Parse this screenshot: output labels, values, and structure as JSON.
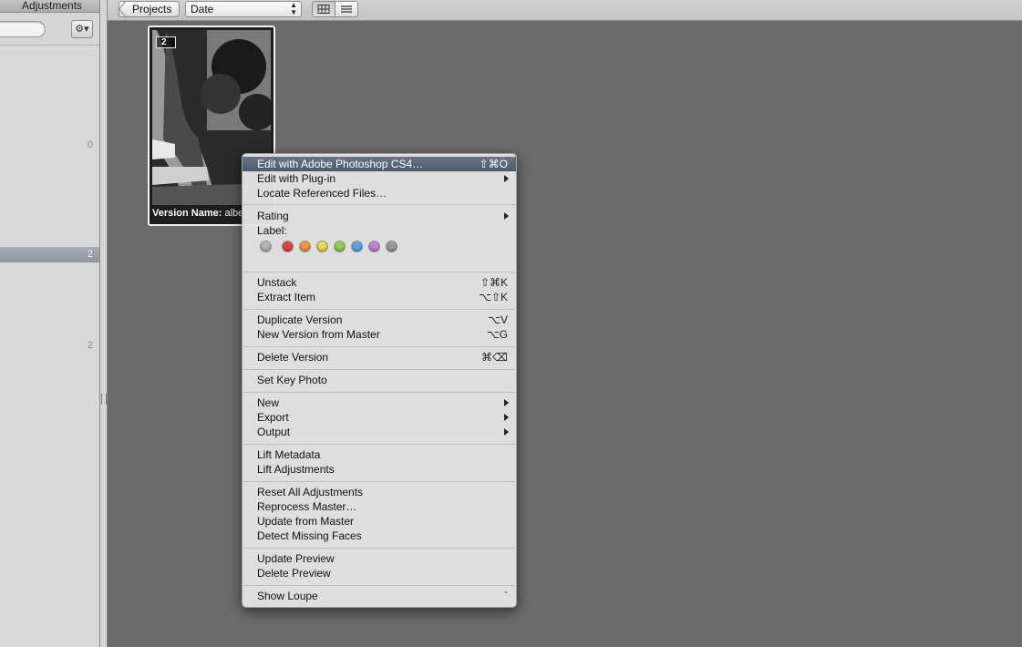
{
  "sidebar": {
    "tab_label": "Adjustments",
    "counts": [
      "0",
      "2",
      "2"
    ]
  },
  "toolbar": {
    "projects_label": "Projects",
    "sort_value": "Date"
  },
  "thumbnail": {
    "stack_count": "2",
    "caption_label": "Version Name:",
    "caption_value": "albe"
  },
  "menu": {
    "items": [
      {
        "label": "Edit with Adobe Photoshop CS4…",
        "shortcut": "⇧⌘O"
      },
      {
        "label": "Edit with Plug-in",
        "submenu": true
      },
      {
        "label": "Locate Referenced Files…"
      },
      {
        "label": "Rating",
        "submenu": true
      },
      {
        "label": "Label:"
      },
      {
        "label": "Unstack",
        "shortcut": "⇧⌘K"
      },
      {
        "label": "Extract Item",
        "shortcut": "⌥⇧K"
      },
      {
        "label": "Duplicate Version",
        "shortcut": "⌥V"
      },
      {
        "label": "New Version from Master",
        "shortcut": "⌥G"
      },
      {
        "label": "Delete Version",
        "shortcut": "⌘⌫"
      },
      {
        "label": "Set Key Photo"
      },
      {
        "label": "New",
        "submenu": true
      },
      {
        "label": "Export",
        "submenu": true
      },
      {
        "label": "Output",
        "submenu": true
      },
      {
        "label": "Lift Metadata"
      },
      {
        "label": "Lift Adjustments"
      },
      {
        "label": "Reset All Adjustments"
      },
      {
        "label": "Reprocess Master…"
      },
      {
        "label": "Update from Master"
      },
      {
        "label": "Detect Missing Faces"
      },
      {
        "label": "Update Preview"
      },
      {
        "label": "Delete Preview"
      },
      {
        "label": "Show Loupe",
        "shortcut": "`"
      }
    ],
    "label_colors": [
      {
        "name": "none",
        "color": "#b4b4b4"
      },
      {
        "name": "red",
        "color": "#e0433c"
      },
      {
        "name": "orange",
        "color": "#f0973a"
      },
      {
        "name": "yellow",
        "color": "#ead94a"
      },
      {
        "name": "green",
        "color": "#8fd14f"
      },
      {
        "name": "blue",
        "color": "#58a3ea"
      },
      {
        "name": "purple",
        "color": "#c57ed8"
      },
      {
        "name": "gray",
        "color": "#9a9a9a"
      }
    ]
  }
}
